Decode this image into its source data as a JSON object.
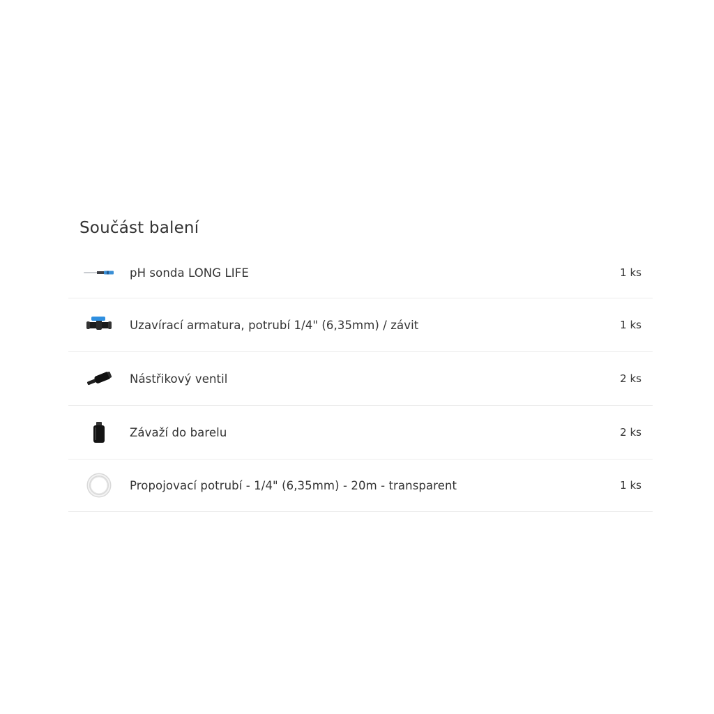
{
  "package": {
    "title": "Součást balení",
    "items": [
      {
        "name": "pH sonda LONG LIFE",
        "qty": "1 ks",
        "icon": "ph-probe-icon"
      },
      {
        "name": "Uzavírací armatura, potrubí 1/4\" (6,35mm) / závit",
        "qty": "1 ks",
        "icon": "shutoff-valve-icon"
      },
      {
        "name": "Nástřikový ventil",
        "qty": "2 ks",
        "icon": "injection-valve-icon"
      },
      {
        "name": "Závaží do barelu",
        "qty": "2 ks",
        "icon": "barrel-weight-icon"
      },
      {
        "name": "Propojovací potrubí - 1/4\" (6,35mm) - 20m - transparent",
        "qty": "1 ks",
        "icon": "tubing-coil-icon"
      }
    ]
  }
}
